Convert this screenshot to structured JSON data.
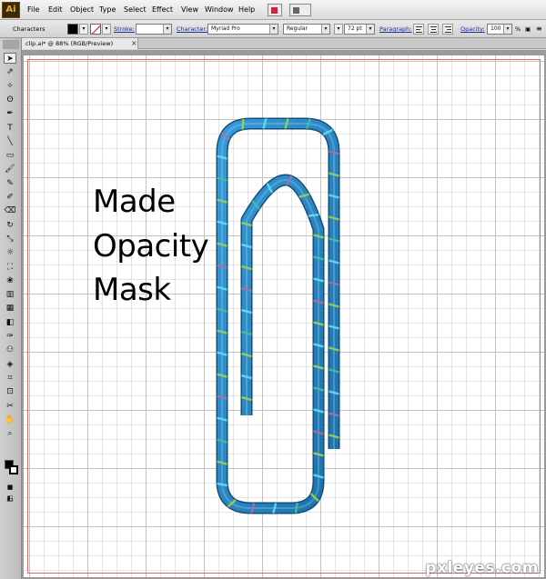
{
  "menubar": {
    "logo": "Ai",
    "menus": [
      "File",
      "Edit",
      "Object",
      "Type",
      "Select",
      "Effect",
      "View",
      "Window",
      "Help"
    ]
  },
  "controlbar": {
    "selection_label": "Characters",
    "stroke_label": "Stroke:",
    "character_label": "Character:",
    "font_family": "Myriad Pro",
    "font_style": "Regular",
    "font_size": "72 pt",
    "paragraph_label": "Paragraph:",
    "opacity_label": "Opacity:",
    "opacity_value": "100",
    "opacity_unit": "%",
    "dropdown_glyph": "▾",
    "close_glyph": "×"
  },
  "document": {
    "tab_title": "clip.ai* @ 88% (RGB/Preview)",
    "tab_close": "×"
  },
  "canvas": {
    "caption_lines": [
      "Made",
      "Opacity",
      "Mask"
    ]
  },
  "tools": [
    {
      "name": "selection-tool-icon",
      "glyph": "➤"
    },
    {
      "name": "direct-selection-tool-icon",
      "glyph": "⇗"
    },
    {
      "name": "magic-wand-tool-icon",
      "glyph": "✧"
    },
    {
      "name": "lasso-tool-icon",
      "glyph": "ʘ"
    },
    {
      "name": "pen-tool-icon",
      "glyph": "✒"
    },
    {
      "name": "type-tool-icon",
      "glyph": "T"
    },
    {
      "name": "line-tool-icon",
      "glyph": "╲"
    },
    {
      "name": "rectangle-tool-icon",
      "glyph": "▭"
    },
    {
      "name": "paintbrush-tool-icon",
      "glyph": "🖌"
    },
    {
      "name": "pencil-tool-icon",
      "glyph": "✎"
    },
    {
      "name": "blob-brush-tool-icon",
      "glyph": "✐"
    },
    {
      "name": "eraser-tool-icon",
      "glyph": "⌫"
    },
    {
      "name": "rotate-tool-icon",
      "glyph": "↻"
    },
    {
      "name": "scale-tool-icon",
      "glyph": "⤡"
    },
    {
      "name": "warp-tool-icon",
      "glyph": "☼"
    },
    {
      "name": "free-transform-tool-icon",
      "glyph": "⛶"
    },
    {
      "name": "symbol-sprayer-tool-icon",
      "glyph": "❀"
    },
    {
      "name": "graph-tool-icon",
      "glyph": "▥"
    },
    {
      "name": "mesh-tool-icon",
      "glyph": "▦"
    },
    {
      "name": "gradient-tool-icon",
      "glyph": "◧"
    },
    {
      "name": "eyedropper-tool-icon",
      "glyph": "✑"
    },
    {
      "name": "blend-tool-icon",
      "glyph": "⚇"
    },
    {
      "name": "live-paint-bucket-tool-icon",
      "glyph": "◈"
    },
    {
      "name": "live-paint-selection-tool-icon",
      "glyph": "⌗"
    },
    {
      "name": "crop-area-tool-icon",
      "glyph": "⊡"
    },
    {
      "name": "slice-tool-icon",
      "glyph": "✂"
    },
    {
      "name": "hand-tool-icon",
      "glyph": "✋"
    },
    {
      "name": "zoom-tool-icon",
      "glyph": "⌕"
    }
  ],
  "watermark": "pxleyes.com",
  "colors": {
    "clip_blue": "#2a86c4",
    "clip_highlight": "#7fd4ff",
    "stripe_green": "#9fd34a",
    "stripe_purple": "#b56aa0",
    "stripe_cyan": "#5fe0f0",
    "stripe_teal": "#3ec39a"
  }
}
